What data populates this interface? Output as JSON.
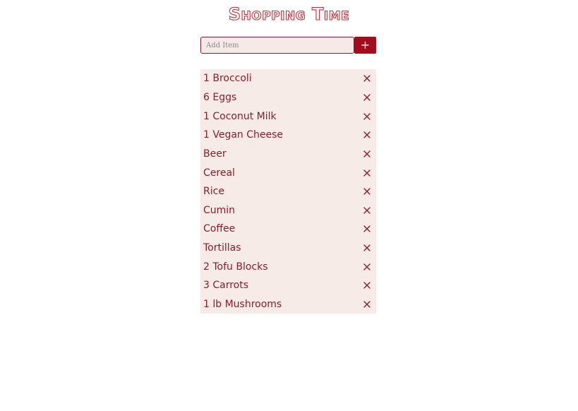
{
  "app": {
    "title": "Shopping Time"
  },
  "add_form": {
    "placeholder": "Add Item",
    "add_button_label": "+"
  },
  "colors": {
    "accent": "#a10d1c",
    "text": "#8e1c2c",
    "list_background": "#f7ebe8",
    "input_border": "#7a1f3a"
  },
  "items": [
    {
      "label": "1 Broccoli",
      "remove_icon": "close-icon"
    },
    {
      "label": "6 Eggs",
      "remove_icon": "close-icon"
    },
    {
      "label": "1 Coconut Milk",
      "remove_icon": "close-icon"
    },
    {
      "label": "1 Vegan Cheese",
      "remove_icon": "close-icon"
    },
    {
      "label": "Beer",
      "remove_icon": "close-icon"
    },
    {
      "label": "Cereal",
      "remove_icon": "close-icon"
    },
    {
      "label": "Rice",
      "remove_icon": "close-icon"
    },
    {
      "label": "Cumin",
      "remove_icon": "close-icon"
    },
    {
      "label": "Coffee",
      "remove_icon": "close-icon"
    },
    {
      "label": "Tortillas",
      "remove_icon": "close-icon"
    },
    {
      "label": "2 Tofu Blocks",
      "remove_icon": "close-icon"
    },
    {
      "label": "3 Carrots",
      "remove_icon": "close-icon"
    },
    {
      "label": "1 lb Mushrooms",
      "remove_icon": "close-icon"
    }
  ]
}
